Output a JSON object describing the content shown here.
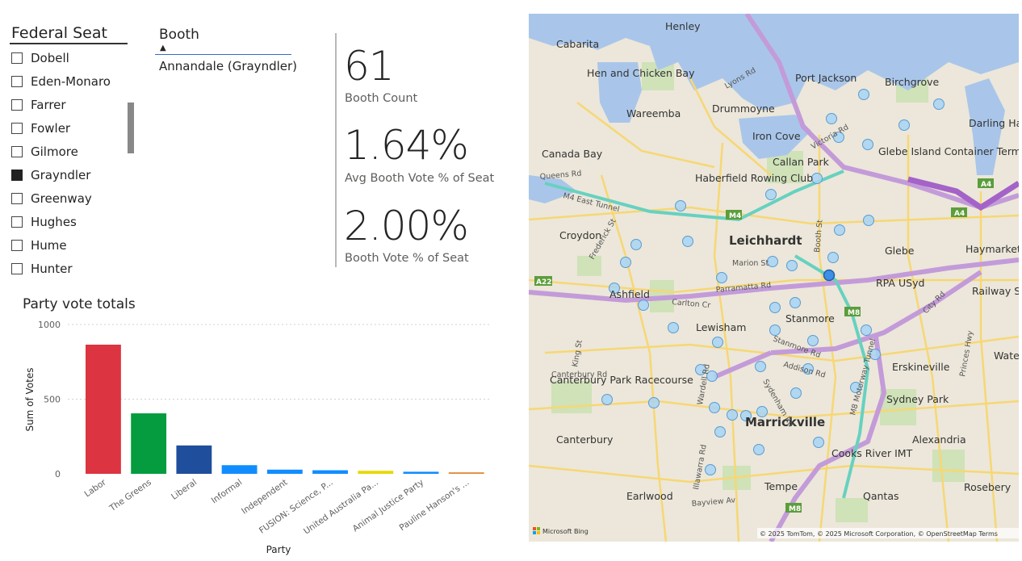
{
  "federal_seat": {
    "title": "Federal Seat",
    "items": [
      {
        "label": "Dobell",
        "checked": false
      },
      {
        "label": "Eden-Monaro",
        "checked": false
      },
      {
        "label": "Farrer",
        "checked": false
      },
      {
        "label": "Fowler",
        "checked": false
      },
      {
        "label": "Gilmore",
        "checked": false
      },
      {
        "label": "Grayndler",
        "checked": true
      },
      {
        "label": "Greenway",
        "checked": false
      },
      {
        "label": "Hughes",
        "checked": false
      },
      {
        "label": "Hume",
        "checked": false
      },
      {
        "label": "Hunter",
        "checked": false
      }
    ]
  },
  "booth": {
    "title": "Booth",
    "selected": "Annandale (Grayndler)"
  },
  "kpis": {
    "booth_count": {
      "value": "61",
      "label": "Booth Count"
    },
    "avg_booth_vote": {
      "value": "1.64%",
      "label": "Avg Booth Vote % of Seat"
    },
    "booth_vote": {
      "value": "2.00%",
      "label": "Booth Vote % of Seat"
    }
  },
  "chart_data": {
    "type": "bar",
    "title": "Party vote totals",
    "xlabel": "Party",
    "ylabel": "Sum of Votes",
    "ylim": [
      0,
      1000
    ],
    "yticks": [
      0,
      500,
      1000
    ],
    "grid": true,
    "categories": [
      "Labor",
      "The Greens",
      "Liberal",
      "Informal",
      "Independent",
      "FUSION: Science, P...",
      "United Australia Pa...",
      "Animal Justice Party",
      "Pauline Hanson's ..."
    ],
    "values": [
      865,
      405,
      190,
      58,
      28,
      24,
      20,
      14,
      10
    ],
    "colors": [
      "#dc3440",
      "#049c3f",
      "#1f4e9c",
      "#118dff",
      "#118dff",
      "#118dff",
      "#e6d800",
      "#118dff",
      "#e08a3c"
    ]
  },
  "map": {
    "attribution": "© 2025 TomTom, © 2025 Microsoft Corporation, © OpenStreetMap  Terms",
    "provider": "Microsoft Bing",
    "suburbs": [
      "Henley",
      "Cabarita",
      "Hen and Chicken Bay",
      "Wareemba",
      "Drummoyne",
      "Port Jackson",
      "Birchgrove",
      "Darling Harbour",
      "Canada Bay",
      "Iron Cove",
      "Callan Park",
      "Glebe Island Container Terminal",
      "Haberfield Rowing Club",
      "Croydon",
      "Leichhardt",
      "Glebe",
      "Haymarket",
      "Ashfield",
      "RPA",
      "USyd",
      "Railway Square",
      "Lewisham",
      "Stanmore",
      "Erskineville",
      "Waterl",
      "Canterbury Park Racecourse",
      "Marrickville",
      "Sydney Park",
      "Canterbury",
      "Alexandria",
      "Cooks River IMT",
      "Earlwood",
      "Tempe",
      "Qantas",
      "Rosebery"
    ],
    "roads": [
      "Queens Rd",
      "M4 East Tunnel",
      "Victoria Rd",
      "Lyons Rd",
      "Parramatta Rd",
      "King St",
      "City Rd",
      "Stanmore Rd",
      "Addison Rd",
      "Sydenham Rd",
      "Wardell Rd",
      "M8 Motorway Tunnel",
      "Bayview Av",
      "Frederick St",
      "Marion St",
      "Booth St",
      "Carlton Cr",
      "Canterbury Rd",
      "Illawarra Rd",
      "Princes Hwy"
    ],
    "shields": [
      "M4",
      "M4",
      "A4",
      "A4",
      "M8",
      "M8",
      "A22"
    ]
  }
}
